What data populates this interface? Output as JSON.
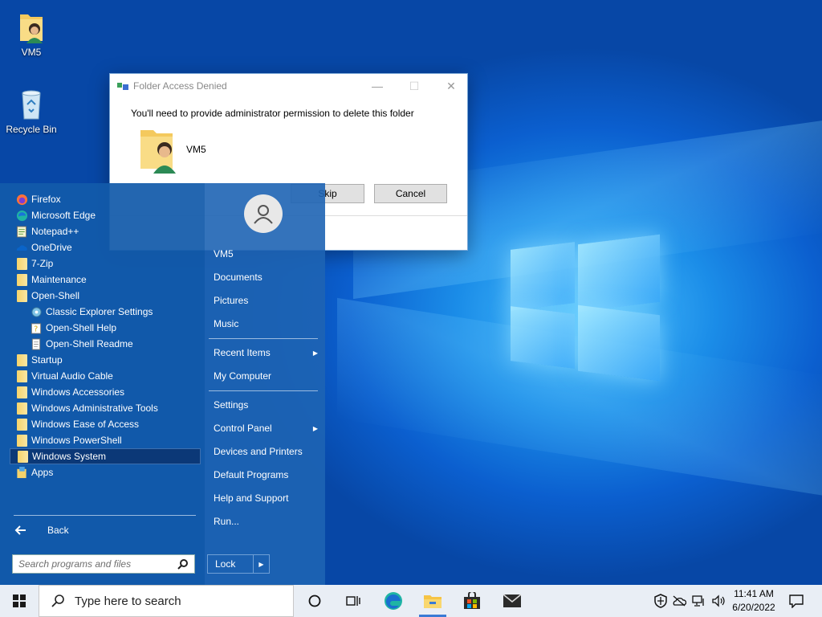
{
  "desktop": {
    "icons": [
      {
        "label": "VM5",
        "icon": "user-folder-icon"
      },
      {
        "label": "Recycle Bin",
        "icon": "recycle-bin-icon"
      }
    ]
  },
  "dialog": {
    "title": "Folder Access Denied",
    "message": "You'll need to provide administrator permission to delete this folder",
    "folder_name": "VM5",
    "skip_label": "Skip",
    "cancel_label": "Cancel"
  },
  "start_menu": {
    "programs": [
      {
        "label": "Firefox",
        "icon": "firefox-icon"
      },
      {
        "label": "Microsoft Edge",
        "icon": "edge-icon"
      },
      {
        "label": "Notepad++",
        "icon": "notepad-plus-plus-icon"
      },
      {
        "label": "OneDrive",
        "icon": "onedrive-icon"
      },
      {
        "label": "7-Zip",
        "icon": "folder-icon"
      },
      {
        "label": "Maintenance",
        "icon": "folder-icon"
      },
      {
        "label": "Open-Shell",
        "icon": "folder-icon"
      },
      {
        "label": "Classic Explorer Settings",
        "icon": "explorer-settings-icon"
      },
      {
        "label": "Open-Shell Help",
        "icon": "help-icon"
      },
      {
        "label": "Open-Shell Readme",
        "icon": "document-icon"
      },
      {
        "label": "Startup",
        "icon": "folder-icon"
      },
      {
        "label": "Virtual Audio Cable",
        "icon": "folder-icon"
      },
      {
        "label": "Windows Accessories",
        "icon": "folder-icon"
      },
      {
        "label": "Windows Administrative Tools",
        "icon": "folder-icon"
      },
      {
        "label": "Windows Ease of Access",
        "icon": "folder-icon"
      },
      {
        "label": "Windows PowerShell",
        "icon": "folder-icon"
      },
      {
        "label": "Windows System",
        "icon": "folder-icon"
      },
      {
        "label": "Apps",
        "icon": "apps-icon"
      }
    ],
    "back_label": "Back",
    "search_placeholder": "Search programs and files",
    "right_items": [
      {
        "label": "VM5"
      },
      {
        "label": "Documents"
      },
      {
        "label": "Pictures"
      },
      {
        "label": "Music"
      },
      {
        "label": "Recent Items"
      },
      {
        "label": "My Computer"
      },
      {
        "label": "Settings"
      },
      {
        "label": "Control Panel"
      },
      {
        "label": "Devices and Printers"
      },
      {
        "label": "Default Programs"
      },
      {
        "label": "Help and Support"
      },
      {
        "label": "Run..."
      }
    ],
    "lock_label": "Lock"
  },
  "taskbar": {
    "search_placeholder": "Type here to search",
    "clock_time": "11:41 AM",
    "clock_date": "6/20/2022"
  }
}
